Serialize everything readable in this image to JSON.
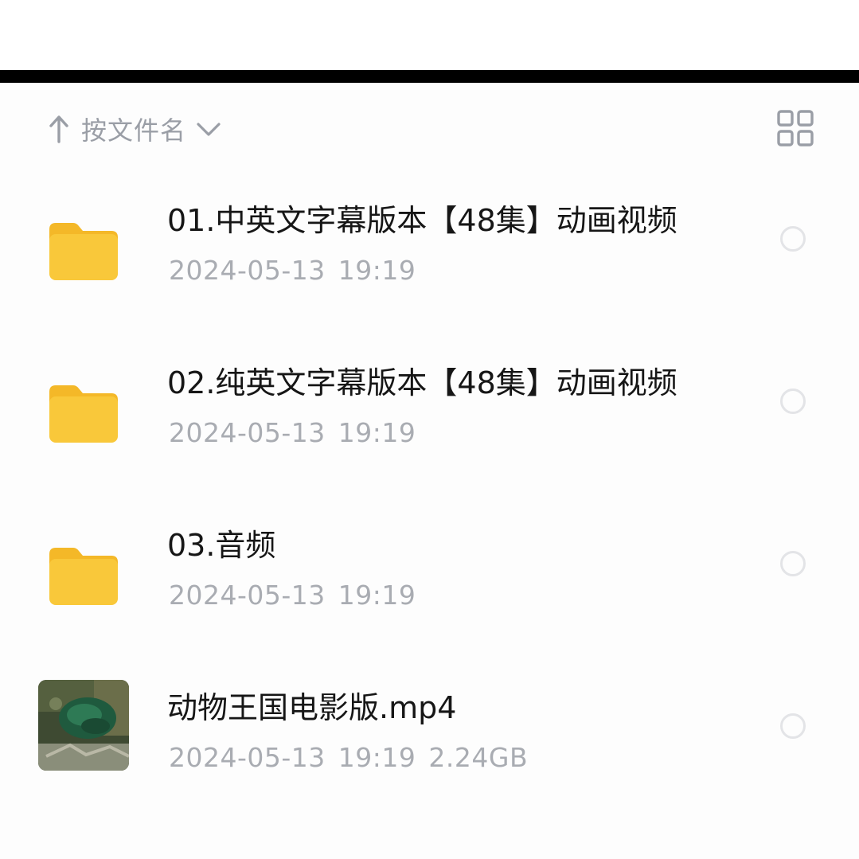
{
  "sort": {
    "label": "按文件名",
    "arrow_icon": "arrow-up-icon",
    "chevron_icon": "chevron-down-icon"
  },
  "view_toggle": {
    "icon": "grid-view-icon"
  },
  "files": [
    {
      "name": "01.中英文字幕版本【48集】动画视频",
      "date": "2024-05-13",
      "time": "19:19",
      "size": "",
      "type": "folder"
    },
    {
      "name": "02.纯英文字幕版本【48集】动画视频",
      "date": "2024-05-13",
      "time": "19:19",
      "size": "",
      "type": "folder"
    },
    {
      "name": "03.音频",
      "date": "2024-05-13",
      "time": "19:19",
      "size": "",
      "type": "folder"
    },
    {
      "name": "动物王国电影版.mp4",
      "date": "2024-05-13",
      "time": "19:19",
      "size": "2.24GB",
      "type": "video"
    }
  ],
  "colors": {
    "folder": "#f9c83a",
    "folder_tab": "#f4b828",
    "text": "#161616",
    "meta": "#a9acb2",
    "icon": "#9a9ea6"
  }
}
